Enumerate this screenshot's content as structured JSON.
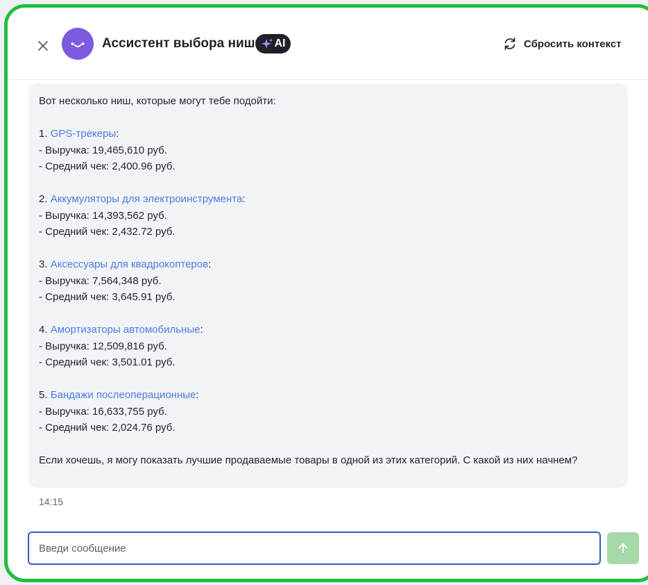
{
  "header": {
    "title": "Ассистент выбора ниши",
    "badge": "AI",
    "reset_label": "Сбросить контекст",
    "icons": {
      "close": "close-icon",
      "avatar": "smiley-icon",
      "badge": "sparkle-icon",
      "reset": "refresh-icon"
    }
  },
  "message": {
    "intro": "Вот несколько ниш, которые могут тебе подойти:",
    "niches": [
      {
        "number": "1.",
        "name": "GPS-трекеры",
        "revenue": "- Выручка: 19,465,610 руб.",
        "avg_check": "- Средний чек: 2,400.96 руб."
      },
      {
        "number": "2.",
        "name": "Аккумуляторы для электроинструмента",
        "revenue": "- Выручка: 14,393,562 руб.",
        "avg_check": "- Средний чек: 2,432.72 руб."
      },
      {
        "number": "3.",
        "name": "Аксессуары для квадрокоптеров",
        "revenue": "- Выручка: 7,564,348 руб.",
        "avg_check": "- Средний чек: 3,645.91 руб."
      },
      {
        "number": "4.",
        "name": "Амортизаторы автомобильные",
        "revenue": "- Выручка: 12,509,816 руб.",
        "avg_check": "- Средний чек: 3,501.01 руб."
      },
      {
        "number": "5.",
        "name": "Бандажи послеоперационные",
        "revenue": "- Выручка: 16,633,755 руб.",
        "avg_check": "- Средний чек: 2,024.76 руб."
      }
    ],
    "outro": "Если хочешь, я могу показать лучшие продаваемые товары в одной из этих категорий. С какой из них начнем?",
    "time": "14:15"
  },
  "composer": {
    "placeholder": "Введи сообщение",
    "value": "",
    "send_icon": "arrow-up-icon"
  },
  "colors": {
    "frame_border": "#1fbf3c",
    "avatar": "#7d5be0",
    "link": "#4a7de0",
    "bubble": "#f2f3f6",
    "input_border": "#2f5fbf",
    "send_button": "#a7d8a9"
  }
}
